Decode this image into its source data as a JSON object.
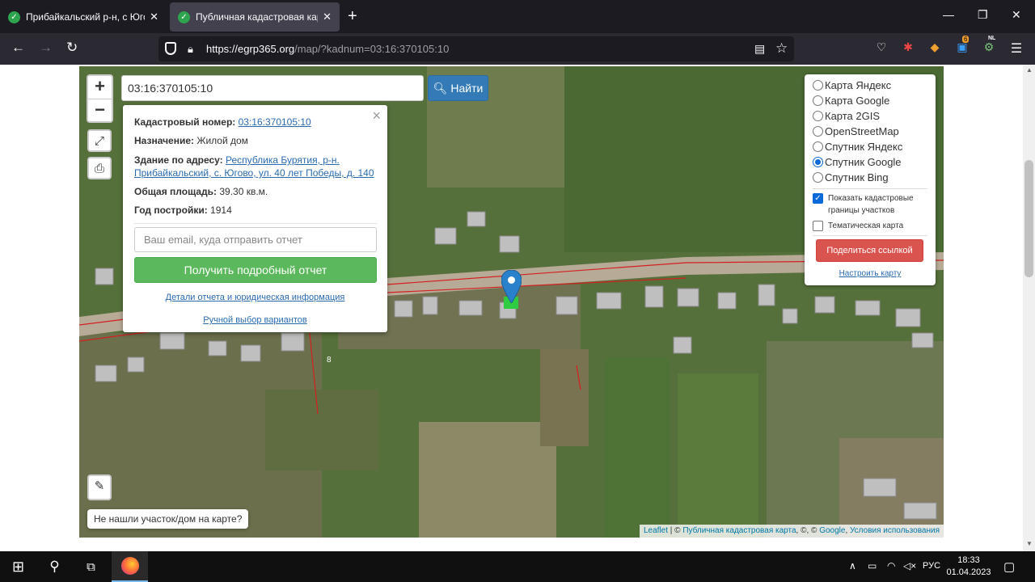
{
  "browser": {
    "tabs": [
      {
        "title": "Прибайкальский р-н, с Югово",
        "active": false
      },
      {
        "title": "Публичная кадастровая карта",
        "active": true
      }
    ],
    "url_host": "https://egrp365.org",
    "url_path": "/map/?kadnum=03:16:370105:10",
    "ext_badge": "6",
    "ext_nl": "NL"
  },
  "search": {
    "value": "03:16:370105:10",
    "button_label": "Найти"
  },
  "popup": {
    "cad_label": "Кадастровый номер:",
    "cad_value": "03:16:370105:10",
    "purpose_label": "Назначение:",
    "purpose_value": "Жилой дом",
    "address_label": "Здание по адресу:",
    "address_line1": "Республика Бурятия, р-н.",
    "address_line2": "Прибайкальский, с. Югово, ул. 40 лет Победы, д. 140",
    "area_label": "Общая площадь:",
    "area_value": "39.30 кв.м.",
    "year_label": "Год постройки:",
    "year_value": "1914",
    "email_placeholder": "Ваш email, куда отправить отчет",
    "report_button": "Получить подробный отчет",
    "details_link": "Детали отчета и юридическая информация",
    "manual_link": "Ручной выбор вариантов"
  },
  "layers": {
    "options": [
      {
        "label": "Карта Яндекс",
        "checked": false
      },
      {
        "label": "Карта Google",
        "checked": false
      },
      {
        "label": "Карта 2GIS",
        "checked": false
      },
      {
        "label": "OpenStreetMap",
        "checked": false
      },
      {
        "label": "Спутник Яндекс",
        "checked": false
      },
      {
        "label": "Спутник Google",
        "checked": true
      },
      {
        "label": "Спутник Bing",
        "checked": false
      }
    ],
    "show_borders_line1": "Показать кадастровые",
    "show_borders_line2": "границы участков",
    "thematic": "Тематическая карта",
    "share_button": "Поделиться ссылкой",
    "configure_link": "Настроить карту"
  },
  "map": {
    "not_found": "Не нашли участок/дом на карте?",
    "attribution_leaflet": "Leaflet",
    "attribution_sep1": " | © ",
    "attribution_pkk": "Публичная кадастровая карта",
    "attribution_sep2": ", ©, © ",
    "attribution_google": "Google",
    "attribution_sep3": ", ",
    "attribution_terms": "Условия использования",
    "parcel_label": "8"
  },
  "taskbar": {
    "lang": "РУС",
    "time": "18:33",
    "date": "01.04.2023"
  },
  "colors": {
    "accent_blue": "#337ab7",
    "report_green": "#5cb85c",
    "share_red": "#d9534f",
    "cadastral_line": "#d42020"
  }
}
